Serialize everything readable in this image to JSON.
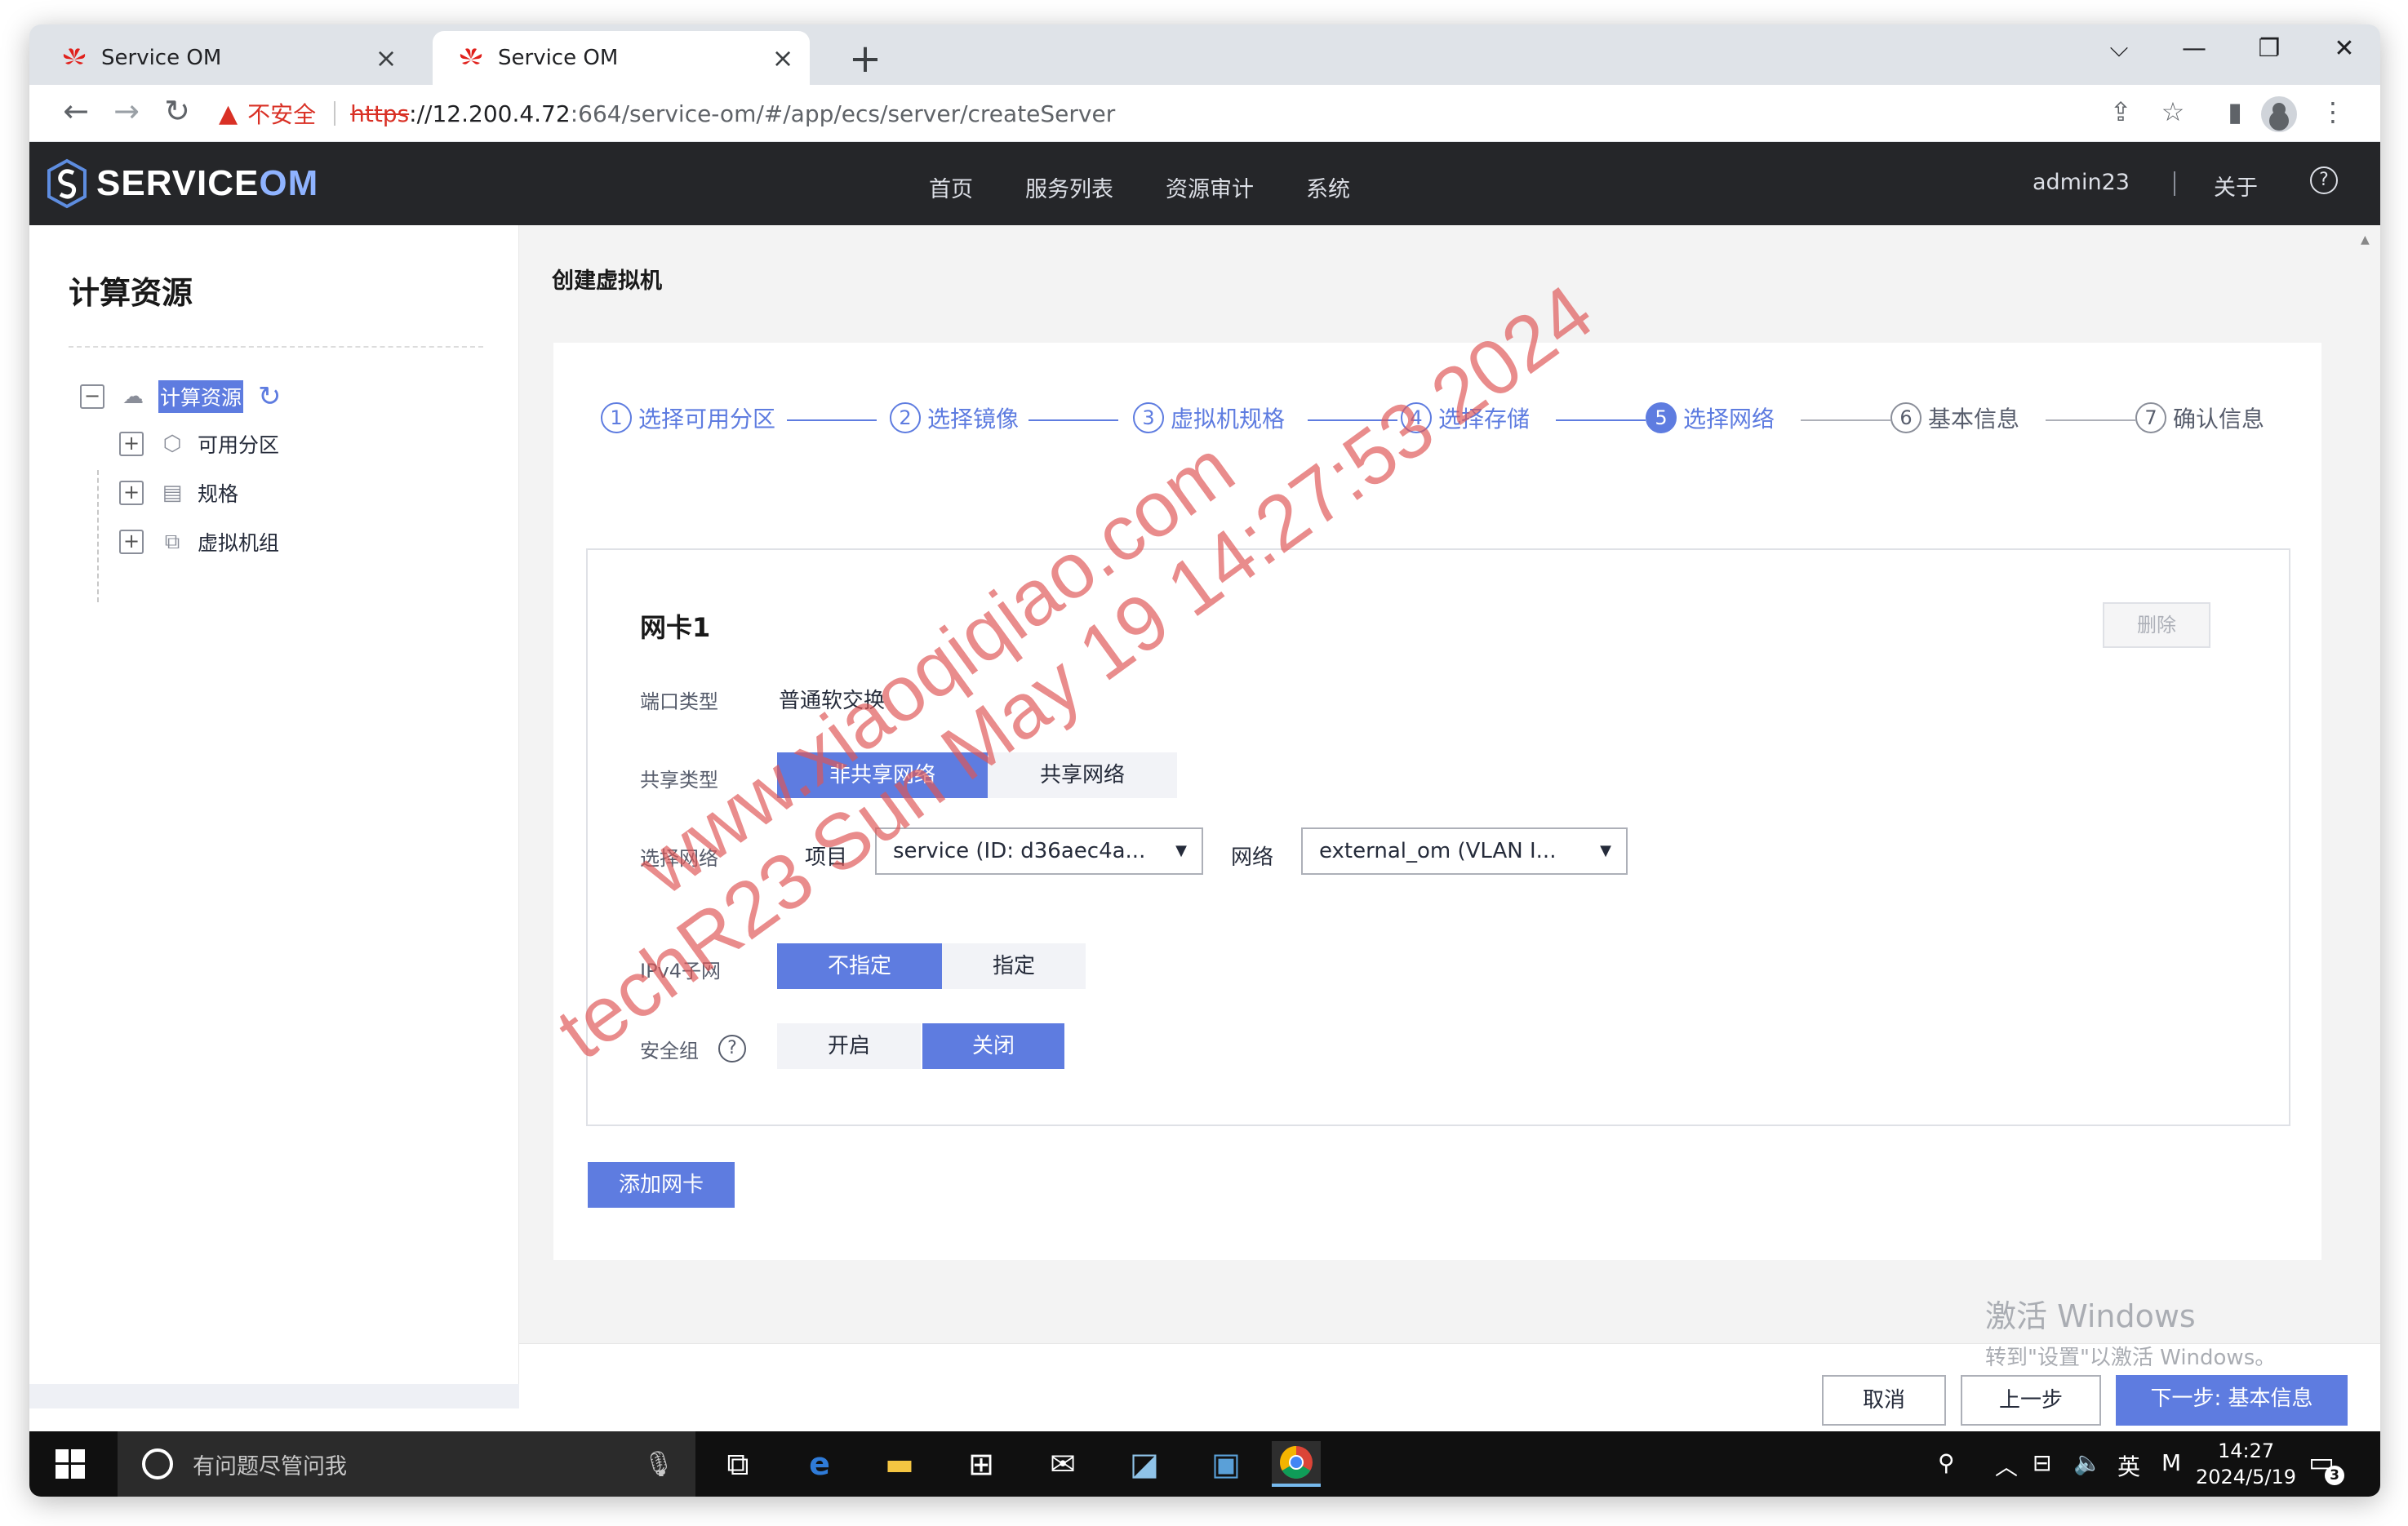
{
  "browser": {
    "tabs": [
      {
        "title": "Service OM",
        "close": "×"
      },
      {
        "title": "Service OM",
        "close": "×"
      }
    ],
    "new_tab": "+",
    "controls": {
      "dropdown": "⌵",
      "minimize": "—",
      "restore": "❐",
      "close": "✕"
    },
    "security_warning": "不安全",
    "url": {
      "protocol": "https",
      "host": "://12.200.4.72",
      "path": ":664/service-om/#/app/ecs/server/createServer"
    }
  },
  "app": {
    "logo_prefix": "SERVICE",
    "logo_suffix": "OM",
    "nav": [
      "首页",
      "服务列表",
      "资源审计",
      "系统"
    ],
    "user": "admin23",
    "about": "关于",
    "help": "?"
  },
  "sidebar": {
    "title": "计算资源",
    "root": "计算资源",
    "children": [
      "可用分区",
      "规格",
      "虚拟机组"
    ]
  },
  "page": {
    "title": "创建虚拟机",
    "steps": [
      {
        "num": "1",
        "label": "选择可用分区"
      },
      {
        "num": "2",
        "label": "选择镜像"
      },
      {
        "num": "3",
        "label": "虚拟机规格"
      },
      {
        "num": "4",
        "label": "选择存储"
      },
      {
        "num": "5",
        "label": "选择网络"
      },
      {
        "num": "6",
        "label": "基本信息"
      },
      {
        "num": "7",
        "label": "确认信息"
      }
    ],
    "current_step": 5,
    "nic": {
      "title": "网卡1",
      "delete": "删除",
      "port_type_label": "端口类型",
      "port_type_value": "普通软交换",
      "share_label": "共享类型",
      "share_options": [
        "非共享网络",
        "共享网络"
      ],
      "share_selected": "非共享网络",
      "network_label": "选择网络",
      "project_label": "项目",
      "project_value": "service (ID: d36aec4a...",
      "net_label": "网络",
      "net_value": "external_om (VLAN I...",
      "ipv4_label": "IPv4子网",
      "ipv4_options": [
        "不指定",
        "指定"
      ],
      "ipv4_selected": "不指定",
      "secgroup_label": "安全组",
      "secgroup_help": "?",
      "secgroup_options": [
        "开启",
        "关闭"
      ],
      "secgroup_selected": "关闭"
    },
    "add_nic": "添加网卡",
    "buttons": {
      "cancel": "取消",
      "prev": "上一步",
      "next": "下一步: 基本信息"
    }
  },
  "activation": {
    "line1": "激活 Windows",
    "line2": "转到\"设置\"以激活 Windows。"
  },
  "watermark": {
    "line1": "www.xiaoqiqiao.com",
    "line2": "techR23 Sun May 19 14:27:53 2024"
  },
  "taskbar": {
    "search_placeholder": "有问题尽管问我",
    "ime": "英",
    "input_mode": "M",
    "time": "14:27",
    "date": "2024/5/19",
    "notifications": "3"
  },
  "colors": {
    "primary": "#5e7ce0",
    "header": "#252629",
    "warning": "#d93025"
  }
}
